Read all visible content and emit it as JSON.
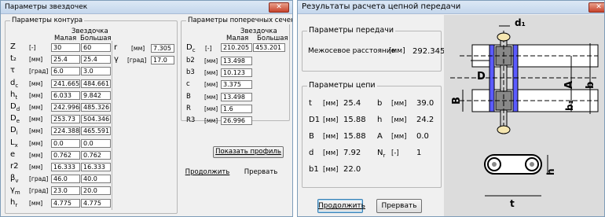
{
  "left": {
    "title": "Параметры звездочек",
    "contour": {
      "title": "Параметры контура",
      "sprocket_header": "Звездочка",
      "col_small": "Малая",
      "col_large": "Большая",
      "rows": [
        {
          "sym": "Z",
          "unit": "[-]",
          "small": "30",
          "large": "60"
        },
        {
          "sym": "t₂",
          "unit": "[мм]",
          "small": "25.4",
          "large": "25.4"
        },
        {
          "sym": "τ",
          "unit": "[град]",
          "small": "6.0",
          "large": "3.0"
        },
        {
          "sym": "d_c",
          "unit": "[мм]",
          "small": "241.665",
          "large": "484.661"
        },
        {
          "sym": "h_t",
          "unit": "[мм]",
          "small": "6.033",
          "large": "9.842"
        },
        {
          "sym": "D_d",
          "unit": "[мм]",
          "small": "242.996",
          "large": "485.326"
        },
        {
          "sym": "D_e",
          "unit": "[мм]",
          "small": "253.73",
          "large": "504.346"
        },
        {
          "sym": "D_i",
          "unit": "[мм]",
          "small": "224.388",
          "large": "465.591"
        },
        {
          "sym": "L_x",
          "unit": "[мм]",
          "small": "0.0",
          "large": "0.0"
        },
        {
          "sym": "e",
          "unit": "[мм]",
          "small": "0.762",
          "large": "0.762"
        },
        {
          "sym": "r2",
          "unit": "[мм]",
          "small": "16.333",
          "large": "16.333"
        },
        {
          "sym": "β_v",
          "unit": "[град]",
          "small": "46.0",
          "large": "40.0"
        },
        {
          "sym": "γ_m",
          "unit": "[град]",
          "small": "23.0",
          "large": "20.0"
        },
        {
          "sym": "h_r",
          "unit": "[мм]",
          "small": "4.775",
          "large": "4.775"
        }
      ],
      "r": {
        "sym": "r",
        "unit": "[мм]",
        "value": "7.305"
      },
      "gamma": {
        "sym": "γ",
        "unit": "[град]",
        "value": "17.0"
      }
    },
    "cross": {
      "title": "Параметры поперечных сечений",
      "sprocket_header": "Звездочка",
      "col_small": "Малая",
      "col_large": "Большая",
      "dc": {
        "sym": "D_c",
        "unit": "[-]",
        "small": "210.205",
        "large": "453.201"
      },
      "rows": [
        {
          "sym": "b2",
          "unit": "[мм]",
          "value": "13.498"
        },
        {
          "sym": "b3",
          "unit": "[мм]",
          "value": "10.123"
        },
        {
          "sym": "c",
          "unit": "[мм]",
          "value": "3.375"
        },
        {
          "sym": "B",
          "unit": "[мм]",
          "value": "13.498"
        },
        {
          "sym": "R",
          "unit": "[мм]",
          "value": "1.6"
        },
        {
          "sym": "R3",
          "unit": "[мм]",
          "value": "26.996"
        }
      ]
    },
    "buttons": {
      "show_profile": "Показать профиль",
      "continue": "Продолжить",
      "abort": "Прервать"
    },
    "close": "✕"
  },
  "right": {
    "title": "Результаты расчета цепной передачи",
    "transmission": {
      "title": "Параметры передачи",
      "label": "Межосевое расстояние",
      "unit": "[мм]",
      "value": "292.345"
    },
    "chain": {
      "title": "Параметры цепи",
      "left_rows": [
        {
          "sym": "t",
          "unit": "[мм]",
          "value": "25.4"
        },
        {
          "sym": "D1",
          "unit": "[мм]",
          "value": "15.88"
        },
        {
          "sym": "B",
          "unit": "[мм]",
          "value": "15.88"
        },
        {
          "sym": "d",
          "unit": "[мм]",
          "value": "7.92"
        },
        {
          "sym": "b1",
          "unit": "[мм]",
          "value": "22.0"
        }
      ],
      "right_rows": [
        {
          "sym": "b",
          "unit": "[мм]",
          "value": "39.0"
        },
        {
          "sym": "h",
          "unit": "[мм]",
          "value": "24.2"
        },
        {
          "sym": "A",
          "unit": "[мм]",
          "value": "0.0"
        },
        {
          "sym": "N_r",
          "unit": "[-]",
          "value": "1"
        }
      ]
    },
    "buttons": {
      "continue": "Продолжить",
      "abort": "Прервать"
    },
    "close": "✕",
    "diagram_labels": {
      "d1": "d₁",
      "D": "D",
      "A": "A",
      "b": "b",
      "B": "B",
      "b1": "b₁",
      "h": "h",
      "t": "t"
    }
  }
}
